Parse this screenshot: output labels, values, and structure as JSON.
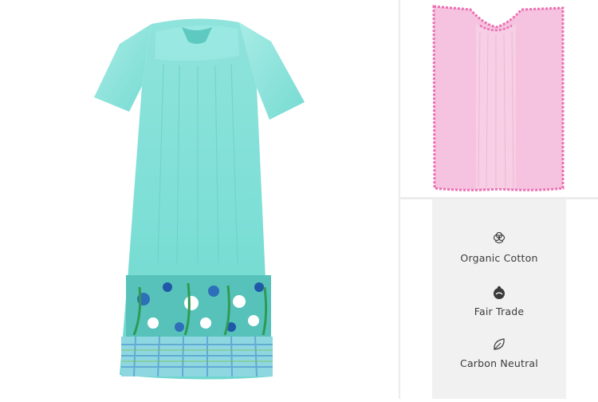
{
  "product_gallery": {
    "main_image": {
      "alt": "Short-sleeve turquoise floral print dress"
    },
    "thumbnail_image": {
      "alt": "Pink ruffle-trim duster, back view"
    }
  },
  "features": {
    "items": [
      {
        "icon": "cotton-flower-icon",
        "label": "Organic Cotton"
      },
      {
        "icon": "fair-trade-icon",
        "label": "Fair Trade"
      },
      {
        "icon": "leaf-icon",
        "label": "Carbon Neutral"
      }
    ]
  },
  "colors": {
    "dress_main": "#7ddfd6",
    "dress_light": "#a8ece6",
    "thumb_pink": "#f5c3df",
    "thumb_trim": "#ec6fb2",
    "feature_card_bg": "#f1f1f1",
    "feature_text": "#3b3b3b"
  }
}
